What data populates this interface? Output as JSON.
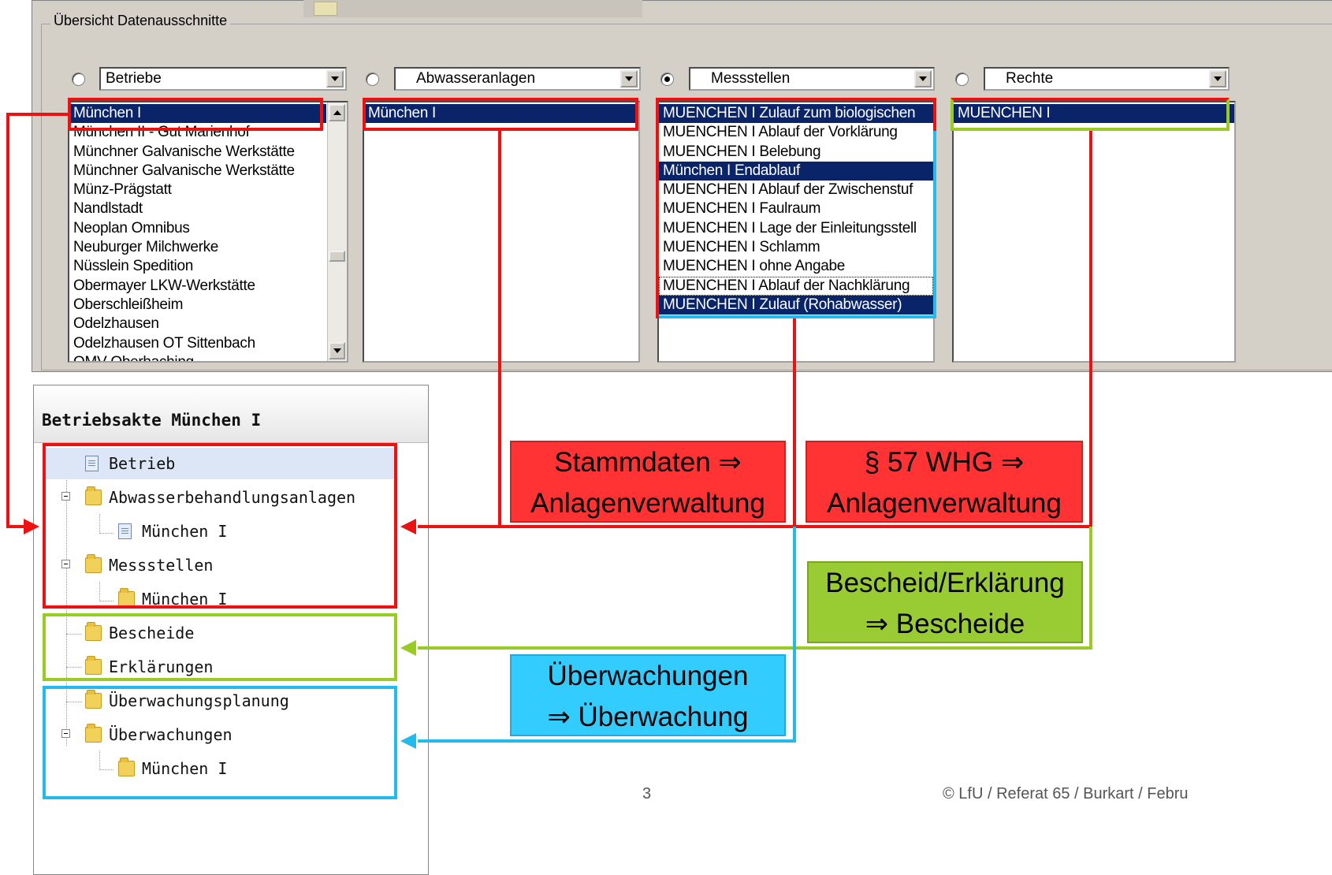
{
  "window": {
    "group_title": "Übersicht Datenausschnitte"
  },
  "columns": [
    {
      "selected_radio": false,
      "combo_value": "Betriebe",
      "items": [
        "München I",
        "München II - Gut Marienhof",
        "Münchner Galvanische Werkstätte",
        "Münchner Galvanische Werkstätte",
        "Münz-Prägstatt",
        "Nandlstadt",
        "Neoplan Omnibus",
        "Neuburger Milchwerke",
        "Nüsslein Spedition",
        "Obermayer LKW-Werkstätte",
        "Oberschleißheim",
        "Odelzhausen",
        "Odelzhausen OT Sittenbach",
        "OMV Oberhaching"
      ],
      "selected_items": [
        0
      ]
    },
    {
      "selected_radio": false,
      "combo_value": "Abwasseranlagen",
      "items": [
        "München I"
      ],
      "selected_items": [
        0
      ]
    },
    {
      "selected_radio": true,
      "combo_value": "Messstellen",
      "items": [
        "MUENCHEN I Zulauf zum biologischen",
        "MUENCHEN I Ablauf der Vorklärung",
        "MUENCHEN I Belebung",
        "München I Endablauf",
        "MUENCHEN I Ablauf der Zwischenstuf",
        "MUENCHEN I Faulraum",
        "MUENCHEN I Lage der Einleitungsstell",
        "MUENCHEN I Schlamm",
        "MUENCHEN I ohne Angabe",
        "MUENCHEN I Ablauf der Nachklärung",
        "MUENCHEN I Zulauf (Rohabwasser)"
      ],
      "selected_items": [
        0,
        3,
        10
      ]
    },
    {
      "selected_radio": false,
      "combo_value": "Rechte",
      "items": [
        "MUENCHEN I"
      ],
      "selected_items": [
        0
      ]
    }
  ],
  "tree": {
    "title": "Betriebsakte München I",
    "nodes": [
      {
        "label": "Betrieb",
        "icon": "document-icon"
      },
      {
        "label": "Abwasserbehandlungsanlagen",
        "icon": "folder-icon"
      },
      {
        "label": "München I",
        "icon": "document-icon"
      },
      {
        "label": "Messstellen",
        "icon": "folder-icon"
      },
      {
        "label": "München I",
        "icon": "folder-icon"
      },
      {
        "label": "Bescheide",
        "icon": "folder-icon"
      },
      {
        "label": "Erklärungen",
        "icon": "folder-icon"
      },
      {
        "label": "Überwachungsplanung",
        "icon": "folder-icon"
      },
      {
        "label": "Überwachungen",
        "icon": "folder-icon"
      },
      {
        "label": "München I",
        "icon": "folder-icon"
      }
    ]
  },
  "annotations": {
    "stammdaten": [
      "Stammdaten ⇒",
      "Anlagenverwaltung"
    ],
    "whg": [
      "§ 57 WHG ⇒",
      "Anlagenverwaltung"
    ],
    "bescheid": [
      "Bescheid/Erklärung",
      "⇒ Bescheide"
    ],
    "ueberwachung": [
      "Überwachungen",
      "⇒ Überwachung"
    ]
  },
  "colors": {
    "red": "#ff3333",
    "green": "#99cc33",
    "cyan": "#33ccff",
    "frame_red": "#ee1111",
    "frame_green": "#99cc22",
    "frame_cyan": "#22bbee"
  },
  "footer": {
    "page_number": "3",
    "credit": "© LfU / Referat 65 / Burkart / Febru"
  }
}
